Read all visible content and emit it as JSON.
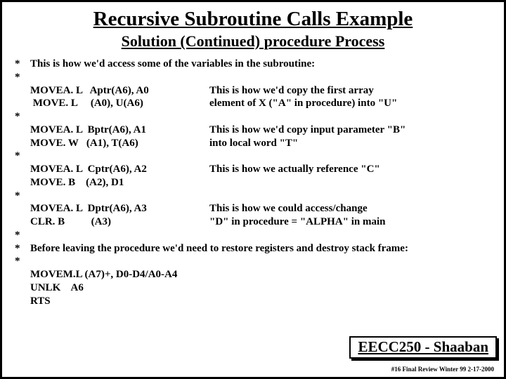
{
  "title": "Recursive Subroutine Calls Example",
  "subtitle": "Solution (Continued)  procedure Process",
  "intro_star": "*",
  "intro": "This is how we'd access some of the variables in the subroutine:",
  "stars": {
    "s": "*"
  },
  "blocks": [
    {
      "code1": "MOVEA. L   Aptr(A6), A0",
      "code2": " MOVE. L     (A0), U(A6)",
      "cmnt1": "This is how we'd copy the first array",
      "cmnt2": " element of  X (\"A\" in procedure) into \"U\""
    },
    {
      "code1": "MOVEA. L  Bptr(A6), A1",
      "code2": "MOVE. W   (A1), T(A6)",
      "cmnt1": "This is how we'd copy input parameter  \"B\"",
      "cmnt2": " into local word  \"T\""
    },
    {
      "code1": "MOVEA. L  Cptr(A6), A2",
      "code2": "MOVE. B    (A2), D1",
      "cmnt1": "This is how we actually reference  \"C\"",
      "cmnt2": ""
    },
    {
      "code1": "MOVEA. L  Dptr(A6), A3",
      "code2": "CLR. B          (A3)",
      "cmnt1": "This is how we could access/change",
      "cmnt2": "\"D\"  in procedure  = \"ALPHA\" in main"
    }
  ],
  "restore_star": "*",
  "restore": "Before leaving the procedure we'd need to restore registers and destroy stack frame:",
  "tail": {
    "l1": "MOVEM.L (A7)+, D0-D4/A0-A4",
    "l2": "UNLK    A6",
    "l3": "RTS"
  },
  "footer_box": "EECC250 - Shaaban",
  "footer_note": "#16  Final Review  Winter 99   2-17-2000"
}
